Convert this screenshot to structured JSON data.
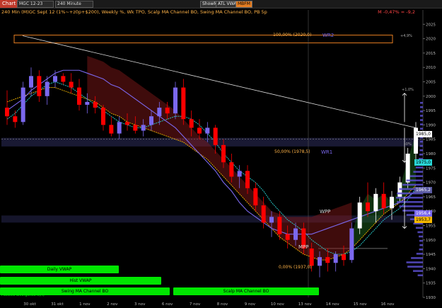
{
  "toolbar": {
    "chart_tab": "Chart",
    "symbol": "MGC 12-23",
    "interval": "240 Minute",
    "btn1": "ShowMa",
    "btn2": "ATL VWAP",
    "btn3": "MBFM"
  },
  "subtitle": "240 Min (M)GC Sept 12 (1%~+z0p+$200), Weekly %, Wk TPO, Scalp MA Channel BO, Swing MA Channel BO, PB 5p",
  "pnl": "M -0,47% = -9,2",
  "annotations": {
    "top_zone": "100,00% (2020,0)",
    "wr2": "WR2",
    "mid_zone": "50,00% (1978,5)",
    "wr1": "WR1",
    "wpp": "WPP",
    "mpp": "MPP",
    "low_zone": "0,00% (1937,0)",
    "pct1": "+4,9%",
    "pct2": "+1,0%",
    "pct3": "-0%"
  },
  "price_labels": {
    "p1": "1985,0",
    "p2": "1975,0",
    "p3": "1965,2",
    "p4": "1956,4",
    "p5": "1953,7"
  },
  "bands": {
    "daily_vwap": "Daily VWAP",
    "hist_vwap": "Hist VWAP",
    "swing_ma": "Swing MA Channel BO",
    "scalp_ma": "Scalp MA Channel BO",
    "bottom_left": "Positive divergence x(H)"
  },
  "colors": {
    "background": "#000000",
    "bull_candle": "#7b68ee",
    "bear_candle": "#ff0000",
    "white_candle": "#ffffff",
    "band_green": "#00e600",
    "trend_purple": "#7b68ee",
    "gold_line": "#f5b800",
    "cyan_line": "#29d6d6"
  },
  "chart_data": {
    "type": "candlestick",
    "title": "240 Min (M)GC Sept 12",
    "ylim": [
      1930,
      2030
    ],
    "yticks": [
      1930,
      1935,
      1940,
      1945,
      1950,
      1955,
      1960,
      1965,
      1970,
      1975,
      1980,
      1985,
      1990,
      1995,
      2000,
      2005,
      2010,
      2015,
      2020,
      2025
    ],
    "xticks": [
      "30 okt",
      "31 okt",
      "1 nov",
      "2 nov",
      "3 nov",
      "6 nov",
      "7 nov",
      "8 nov",
      "9 nov",
      "10 nov",
      "13 nov",
      "14 nov",
      "15 nov",
      "16 nov"
    ],
    "candles": [
      [
        1996,
        2002,
        1990,
        1993
      ],
      [
        1993,
        1995,
        1989,
        1991
      ],
      [
        1991,
        2005,
        1990,
        2003
      ],
      [
        2003,
        2010,
        2000,
        2007
      ],
      [
        2007,
        2009,
        1998,
        2000
      ],
      [
        2000,
        2007,
        1997,
        2005
      ],
      [
        2005,
        2009,
        2003,
        2007
      ],
      [
        2007,
        2008,
        2004,
        2005
      ],
      [
        2005,
        2008,
        2001,
        2003
      ],
      [
        2003,
        2006,
        1995,
        1997
      ],
      [
        1997,
        2001,
        1994,
        1998
      ],
      [
        1998,
        2000,
        1994,
        1996
      ],
      [
        1996,
        1997,
        1988,
        1990
      ],
      [
        1990,
        1993,
        1986,
        1987
      ],
      [
        1987,
        1993,
        1985,
        1991
      ],
      [
        1991,
        1994,
        1988,
        1990
      ],
      [
        1990,
        1993,
        1987,
        1988
      ],
      [
        1988,
        1992,
        1986,
        1990
      ],
      [
        1990,
        1995,
        1988,
        1993
      ],
      [
        1993,
        1998,
        1990,
        1996
      ],
      [
        1996,
        1998,
        1992,
        1994
      ],
      [
        1994,
        2005,
        1992,
        2003
      ],
      [
        2003,
        2006,
        1990,
        1992
      ],
      [
        1992,
        1995,
        1986,
        1989
      ],
      [
        1989,
        1992,
        1985,
        1987
      ],
      [
        1987,
        1991,
        1984,
        1989
      ],
      [
        1989,
        1990,
        1980,
        1983
      ],
      [
        1983,
        1985,
        1975,
        1977
      ],
      [
        1977,
        1980,
        1970,
        1972
      ],
      [
        1972,
        1976,
        1968,
        1974
      ],
      [
        1974,
        1976,
        1966,
        1968
      ],
      [
        1968,
        1970,
        1960,
        1962
      ],
      [
        1962,
        1965,
        1954,
        1956
      ],
      [
        1956,
        1960,
        1951,
        1958
      ],
      [
        1958,
        1960,
        1950,
        1952
      ],
      [
        1952,
        1955,
        1947,
        1950
      ],
      [
        1950,
        1956,
        1948,
        1954
      ],
      [
        1954,
        1956,
        1945,
        1947
      ],
      [
        1947,
        1949,
        1939,
        1941
      ],
      [
        1941,
        1946,
        1937,
        1944
      ],
      [
        1944,
        1947,
        1939,
        1942
      ],
      [
        1942,
        1946,
        1939,
        1945
      ],
      [
        1945,
        1948,
        1941,
        1943
      ],
      [
        1943,
        1956,
        1942,
        1954
      ],
      [
        1954,
        1965,
        1952,
        1963
      ],
      [
        1963,
        1970,
        1958,
        1960
      ],
      [
        1960,
        1968,
        1956,
        1966
      ],
      [
        1966,
        1970,
        1959,
        1961
      ],
      [
        1961,
        1967,
        1957,
        1965
      ],
      [
        1965,
        1972,
        1963,
        1970
      ],
      [
        1970,
        1982,
        1968,
        1980
      ],
      [
        1980,
        1991,
        1978,
        1989
      ]
    ],
    "series": [
      {
        "name": "Swing MA Channel BO",
        "color": "#f5b800",
        "values": [
          1998,
          1999,
          2000,
          2001,
          2002,
          2003,
          2003,
          2002,
          2001,
          2000,
          1999,
          1998,
          1996,
          1994,
          1993,
          1991,
          1990,
          1989,
          1988,
          1987,
          1986,
          1985,
          1984,
          1982,
          1980,
          1978,
          1975,
          1972,
          1969,
          1966,
          1963,
          1960,
          1957,
          1954,
          1951,
          1949,
          1947,
          1945,
          1944,
          1943,
          1943,
          1944,
          1945,
          1947,
          1950,
          1953,
          1956,
          1959,
          1961,
          1963,
          1966,
          1969
        ]
      },
      {
        "name": "Scalp MA Channel BO",
        "color": "#29d6d6",
        "values": [
          1992,
          1994,
          1997,
          2000,
          2002,
          2004,
          2005,
          2004,
          2003,
          2001,
          1999,
          1997,
          1995,
          1993,
          1991,
          1990,
          1989,
          1989,
          1990,
          1991,
          1992,
          1993,
          1993,
          1992,
          1990,
          1987,
          1984,
          1980,
          1977,
          1974,
          1972,
          1970,
          1967,
          1963,
          1960,
          1957,
          1955,
          1953,
          1950,
          1948,
          1946,
          1945,
          1945,
          1946,
          1948,
          1951,
          1954,
          1957,
          1959,
          1961,
          1964,
          1968
        ]
      },
      {
        "name": "Trend",
        "color": "#7b68ee",
        "values": [
          1995,
          1997,
          1999,
          2002,
          2004,
          2006,
          2008,
          2009,
          2009,
          2009,
          2008,
          2007,
          2006,
          2004,
          2003,
          2001,
          1999,
          1997,
          1995,
          1993,
          1991,
          1989,
          1986,
          1983,
          1980,
          1977,
          1974,
          1970,
          1967,
          1963,
          1960,
          1958,
          1956,
          1954,
          1953,
          1952,
          1952,
          1952,
          1952,
          1953,
          1954,
          1955,
          1956,
          1957,
          1958,
          1959,
          1960,
          1961,
          1962,
          1963,
          1965,
          1967
        ]
      }
    ],
    "trendline": {
      "from": [
        0,
        2021
      ],
      "to": [
        51,
        1989
      ]
    },
    "levels": {
      "r2": 2020,
      "r1": 1978.5,
      "pivot": 1957.5,
      "s1": 1937
    }
  }
}
